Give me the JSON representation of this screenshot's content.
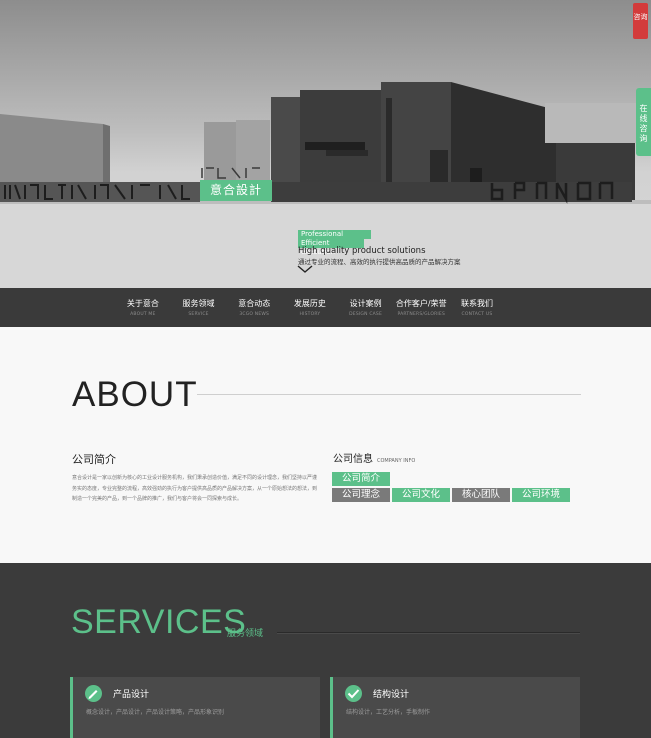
{
  "hero": {
    "brand_box": "意合設計",
    "tag1": "Professional process",
    "tag2": "Efficient execution",
    "headline": "High quality product solutions",
    "subline": "通过专业的流程、高效的执行提供高品质的产品解决方案",
    "side_consult": "咨询",
    "side_online": "在线咨询"
  },
  "nav": {
    "items": [
      {
        "cn": "关于意合",
        "en": "ABOUT ME"
      },
      {
        "cn": "服务领域",
        "en": "SERVICE"
      },
      {
        "cn": "意合动态",
        "en": "3CGO NEWS"
      },
      {
        "cn": "发展历史",
        "en": "HISTORY"
      },
      {
        "cn": "设计案例",
        "en": "DESIGN CASE"
      },
      {
        "cn": "合作客户/荣誉",
        "en": "PARTNERS/GLORIES"
      },
      {
        "cn": "联系我们",
        "en": "CONTACT  US"
      }
    ]
  },
  "about": {
    "title": "ABOUT",
    "intro_heading": "公司简介",
    "intro_text": "意合设计是一家以创新为核心的工业设计服务机构，我们秉承创造价值，满足不同的设计理念，我们坚持以严谨务实的态度，专业完整的流程，高效强劲的执行为客户提供高品质的产品解决方案，从一个原始想法的想法，到制造一个完美的产品，到一个品牌的推广，我们与客户将会一同探索与成长。",
    "info_heading": "公司信息",
    "info_heading_en": "COMPANY  INFO",
    "tabs": [
      "公司简介",
      "公司理念",
      "公司文化",
      "核心团队",
      "公司环境"
    ]
  },
  "services": {
    "title": "SERVICES",
    "subtitle": "服务领域",
    "cards": [
      {
        "title": "产品设计",
        "desc": "概念设计，产品设计，产品设计策略，产品形象识别"
      },
      {
        "title": "结构设计",
        "desc": "结构设计，工艺分析，手板制作"
      }
    ]
  },
  "colors": {
    "accent": "#5cc08a",
    "nav_bg": "#3a3a3a",
    "services_bg": "#3b3b3b",
    "consult_red": "#d33b3b"
  }
}
